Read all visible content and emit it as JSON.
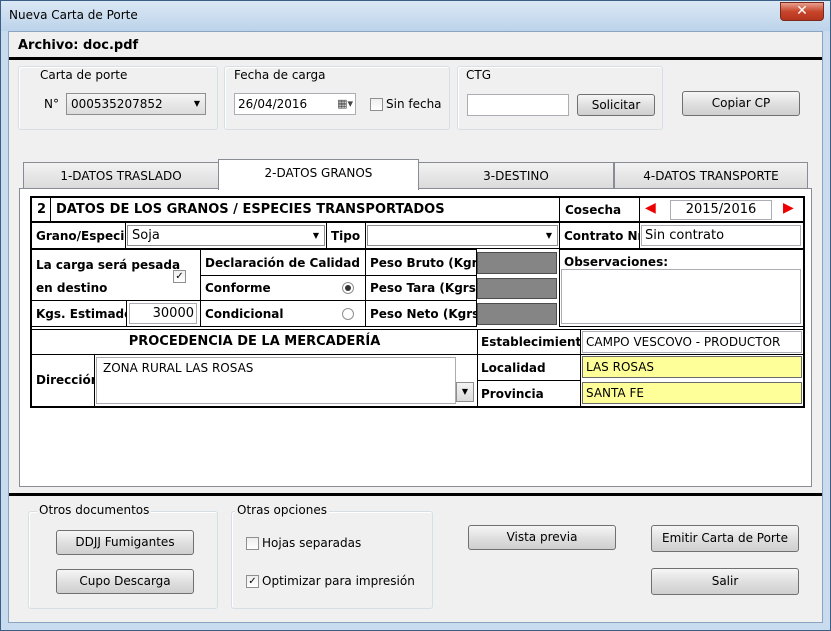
{
  "window": {
    "title": "Nueva Carta de Porte",
    "close": "✕"
  },
  "archivo": "Archivo: doc.pdf",
  "carta_porte": {
    "group_label": "Carta de porte",
    "nro_label": "N°",
    "nro_value": "000535207852"
  },
  "fecha_carga": {
    "group_label": "Fecha de carga",
    "value": "26/04/2016",
    "sin_fecha_label": "Sin fecha",
    "sin_fecha_checked": false
  },
  "ctg": {
    "group_label": "CTG",
    "value": "",
    "solicitar_label": "Solicitar"
  },
  "copiar_cp_label": "Copiar CP",
  "tabs": [
    {
      "label": "1-DATOS TRASLADO"
    },
    {
      "label": "2-DATOS GRANOS"
    },
    {
      "label": "3-DESTINO"
    },
    {
      "label": "4-DATOS TRANSPORTE"
    }
  ],
  "granos": {
    "section_num": "2",
    "section_title": "DATOS DE LOS GRANOS / ESPECIES TRANSPORTADOS",
    "cosecha_label": "Cosecha",
    "cosecha_value": "2015/2016",
    "grano_label": "Grano/Especie",
    "grano_value": "Soja",
    "tipo_label": "Tipo",
    "tipo_value": "",
    "contrato_label": "Contrato Nro",
    "contrato_value": "Sin contrato",
    "pesada_label_1": "La carga será pesada",
    "pesada_label_2": "en destino",
    "pesada_checked": true,
    "declaracion_label": "Declaración de Calidad",
    "conforme_label": "Conforme",
    "condicional_label": "Condicional",
    "calidad_selected": "Conforme",
    "peso_bruto_label": "Peso Bruto (Kgrs.)",
    "peso_tara_label": "Peso Tara (Kgrs.)",
    "peso_neto_label": "Peso Neto (Kgrs.)",
    "observaciones_label": "Observaciones:",
    "kgs_estimados_label": "Kgs. Estimados",
    "kgs_estimados_value": "30000"
  },
  "procedencia": {
    "title": "PROCEDENCIA DE LA MERCADERÍA",
    "direccion_label": "Dirección",
    "direccion_value": "ZONA RURAL LAS ROSAS",
    "establecimiento_label": "Establecimiento",
    "establecimiento_value": "CAMPO VESCOVO - PRODUCTOR",
    "localidad_label": "Localidad",
    "localidad_value": "LAS ROSAS",
    "provincia_label": "Provincia",
    "provincia_value": "SANTA FE"
  },
  "otros_documentos": {
    "group_label": "Otros documentos",
    "ddjj_label": "DDJJ Fumigantes",
    "cupo_label": "Cupo Descarga"
  },
  "otras_opciones": {
    "group_label": "Otras opciones",
    "hojas_label": "Hojas separadas",
    "hojas_checked": false,
    "optimizar_label": "Optimizar para impresión",
    "optimizar_checked": true
  },
  "vista_previa_label": "Vista previa",
  "emitir_label": "Emitir Carta de Porte",
  "salir_label": "Salir",
  "icons": {
    "calendar": "calendar-icon",
    "dropdown": "chevron-down-icon",
    "prev": "arrow-left-icon",
    "next": "arrow-right-icon",
    "check": "✓"
  }
}
